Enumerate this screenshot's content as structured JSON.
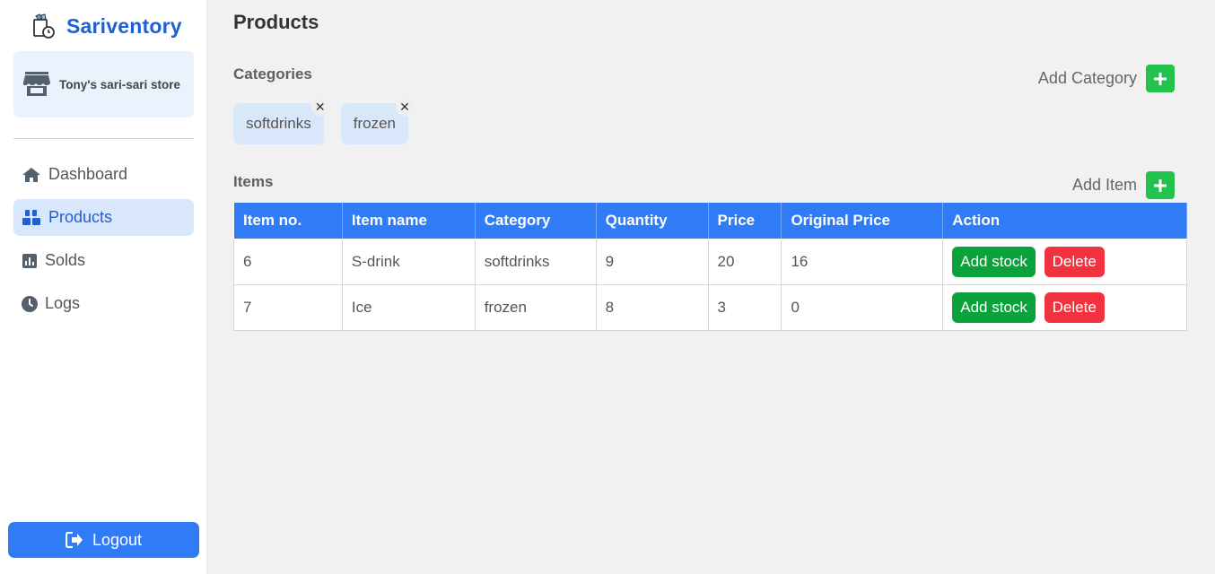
{
  "brand": {
    "name": "Sariventory"
  },
  "store": {
    "name": "Tony's sari-sari store"
  },
  "nav": [
    {
      "label": "Dashboard",
      "icon": "home-icon",
      "active": false
    },
    {
      "label": "Products",
      "icon": "boxes-icon",
      "active": true
    },
    {
      "label": "Solds",
      "icon": "bar-chart-icon",
      "active": false
    },
    {
      "label": "Logs",
      "icon": "clock-icon",
      "active": false
    }
  ],
  "logout": {
    "label": "Logout"
  },
  "page": {
    "title": "Products"
  },
  "categories": {
    "title": "Categories",
    "add_label": "Add Category",
    "items": [
      "softdrinks",
      "frozen"
    ]
  },
  "items": {
    "title": "Items",
    "add_label": "Add Item",
    "columns": [
      "Item no.",
      "Item name",
      "Category",
      "Quantity",
      "Price",
      "Original Price",
      "Action"
    ],
    "rows": [
      {
        "no": "6",
        "name": "S-drink",
        "category": "softdrinks",
        "quantity": "9",
        "price": "20",
        "original_price": "16"
      },
      {
        "no": "7",
        "name": "Ice",
        "category": "frozen",
        "quantity": "8",
        "price": "3",
        "original_price": "0"
      }
    ],
    "actions": {
      "add_stock": "Add stock",
      "delete": "Delete"
    }
  },
  "colors": {
    "primary": "#2f7cf6",
    "brand": "#1f5fd4",
    "success": "#0aa33b",
    "add": "#22c24d",
    "danger": "#f2323f"
  }
}
